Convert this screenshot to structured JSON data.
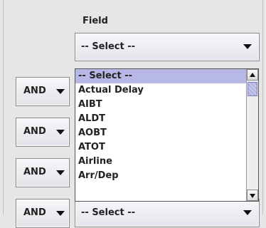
{
  "field": {
    "label": "Field"
  },
  "combo": {
    "value": "-- Select --"
  },
  "and_buttons": [
    {
      "label": "AND"
    },
    {
      "label": "AND"
    },
    {
      "label": "AND"
    },
    {
      "label": "AND"
    }
  ],
  "dropdown": {
    "items": [
      {
        "label": "-- Select --",
        "selected": true
      },
      {
        "label": "Actual Delay"
      },
      {
        "label": "AIBT"
      },
      {
        "label": "ALDT"
      },
      {
        "label": "AOBT"
      },
      {
        "label": "ATOT"
      },
      {
        "label": "Airline"
      },
      {
        "label": "Arr/Dep"
      }
    ]
  },
  "bottom_combo": {
    "value": "-- Select --"
  },
  "colors": {
    "selection": "#b8b8e6",
    "background": "#e6e6e6"
  }
}
